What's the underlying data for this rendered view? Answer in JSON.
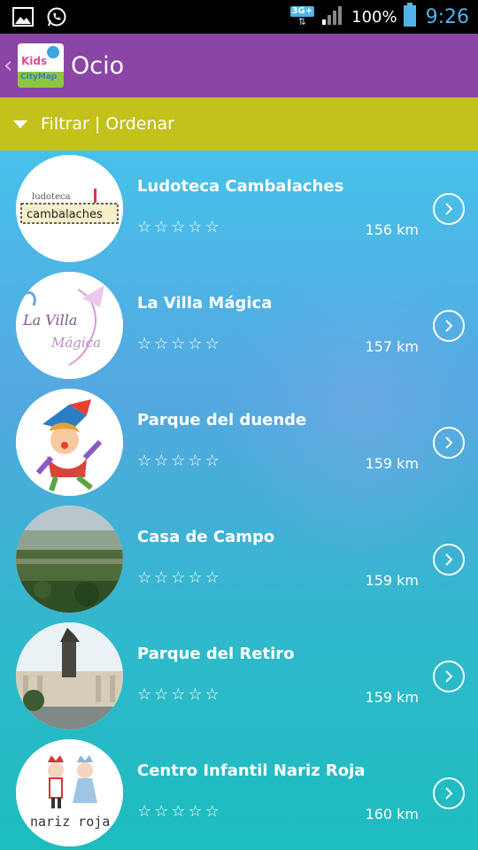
{
  "status": {
    "network": "3G+",
    "battery": "100%",
    "time": "9:26"
  },
  "header": {
    "title": "Ocio",
    "logo_text_1": "Kids",
    "logo_text_2": "CityMap"
  },
  "filter": {
    "label": "Filtrar | Ordenar"
  },
  "items": [
    {
      "name": "Ludoteca Cambalaches",
      "distance": "156 km",
      "rating": 0,
      "thumb_text_1": "ludoteca",
      "thumb_text_2": "cambalaches"
    },
    {
      "name": "La Villa Mágica",
      "distance": "157 km",
      "rating": 0,
      "thumb_text_1": "La Villa",
      "thumb_text_2": "Mágica"
    },
    {
      "name": "Parque del duende",
      "distance": "159 km",
      "rating": 0
    },
    {
      "name": "Casa de Campo",
      "distance": "159 km",
      "rating": 0
    },
    {
      "name": "Parque del Retiro",
      "distance": "159 km",
      "rating": 0
    },
    {
      "name": "Centro Infantil Nariz Roja",
      "distance": "160 km",
      "rating": 0,
      "thumb_text_1": "nariz roja"
    }
  ]
}
